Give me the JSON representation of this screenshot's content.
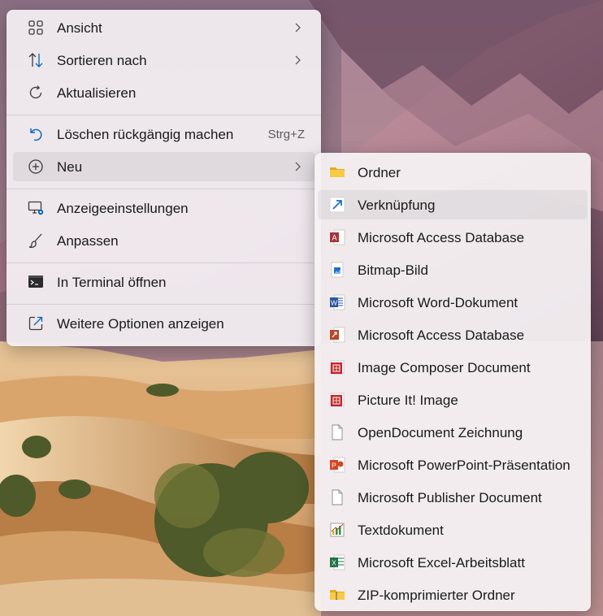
{
  "context_menu": {
    "items": [
      {
        "label": "Ansicht",
        "icon": "grid-icon",
        "has_submenu": true
      },
      {
        "label": "Sortieren nach",
        "icon": "sort-icon",
        "has_submenu": true
      },
      {
        "label": "Aktualisieren",
        "icon": "refresh-icon",
        "has_submenu": false
      },
      {
        "label": "Löschen rückgängig machen",
        "icon": "undo-icon",
        "shortcut": "Strg+Z"
      },
      {
        "label": "Neu",
        "icon": "plus-circle-icon",
        "has_submenu": true,
        "active": true
      },
      {
        "label": "Anzeigeeinstellungen",
        "icon": "display-settings-icon"
      },
      {
        "label": "Anpassen",
        "icon": "brush-icon"
      },
      {
        "label": "In Terminal öffnen",
        "icon": "terminal-icon"
      },
      {
        "label": "Weitere Optionen anzeigen",
        "icon": "share-icon"
      }
    ]
  },
  "submenu": {
    "items": [
      {
        "label": "Ordner",
        "icon": "folder-icon"
      },
      {
        "label": "Verknüpfung",
        "icon": "shortcut-arrow-icon",
        "hover": true
      },
      {
        "label": "Microsoft Access Database",
        "icon": "access-icon"
      },
      {
        "label": "Bitmap-Bild",
        "icon": "bitmap-icon"
      },
      {
        "label": "Microsoft Word-Dokument",
        "icon": "word-icon"
      },
      {
        "label": "Microsoft Access Database",
        "icon": "access-2-icon"
      },
      {
        "label": "Image Composer Document",
        "icon": "image-composer-icon"
      },
      {
        "label": "Picture It! Image",
        "icon": "picture-it-icon"
      },
      {
        "label": "OpenDocument Zeichnung",
        "icon": "blank-document-icon"
      },
      {
        "label": "Microsoft PowerPoint-Präsentation",
        "icon": "powerpoint-icon"
      },
      {
        "label": "Microsoft Publisher Document",
        "icon": "blank-document-icon"
      },
      {
        "label": "Textdokument",
        "icon": "chart-document-icon"
      },
      {
        "label": "Microsoft Excel-Arbeitsblatt",
        "icon": "excel-icon"
      },
      {
        "label": "ZIP-komprimierter Ordner",
        "icon": "zip-folder-icon"
      }
    ]
  },
  "colors": {
    "accent": "#0067c0",
    "menu_background": "#f3eef2",
    "text": "#1a1a1a"
  }
}
